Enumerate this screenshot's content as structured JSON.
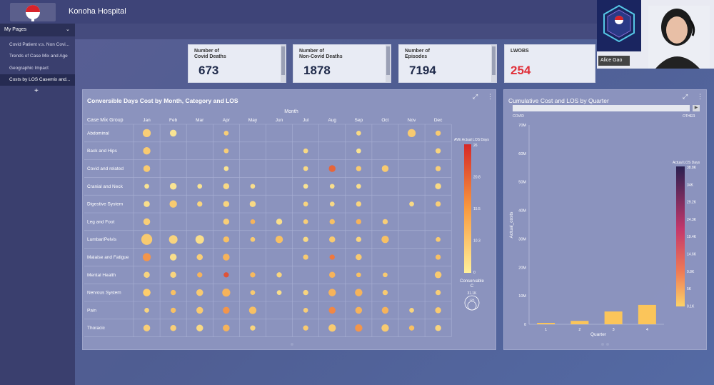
{
  "app": {
    "title": "Konoha Hospital"
  },
  "sidebar": {
    "header": "My Pages",
    "items": [
      {
        "label": "Covid Patient v.s. Non Covi..."
      },
      {
        "label": "Trends of Case Mix and Age"
      },
      {
        "label": "Geographic Impact"
      },
      {
        "label": "Costs by LOS Casemix and..."
      }
    ],
    "add_label": "+"
  },
  "kpis": [
    {
      "label": "Number of\nCovid Deaths",
      "value": "673",
      "color": "#1f2a4a"
    },
    {
      "label": "Number of\nNon-Covid Deaths",
      "value": "1878",
      "color": "#1f2a4a"
    },
    {
      "label": "Number of\nEpisodes",
      "value": "7194",
      "color": "#1f2a4a"
    },
    {
      "label": "LWOBS",
      "value": "254",
      "color": "#e0303a"
    }
  ],
  "video": {
    "name": "Alice Gao"
  },
  "chart_data": [
    {
      "type": "scatter",
      "title": "Conversible Days Cost by Month, Category and LOS",
      "xlabel": "Month",
      "ylabel": "Case Mix Group",
      "categories_x": [
        "Jan",
        "Feb",
        "Mar",
        "Apr",
        "May",
        "Jun",
        "Jul",
        "Aug",
        "Sep",
        "Oct",
        "Nov",
        "Dec"
      ],
      "categories_y": [
        "Abdominal",
        "Back and Hips",
        "Covid and related",
        "Cranial and Neck",
        "Digestive System",
        "Leg and Foot",
        "Lumbar/Pelvis",
        "Malaise and Fatigue",
        "Mental Health",
        "Nervous System",
        "Pain",
        "Thoracic"
      ],
      "color_legend": {
        "title": "AVE Actual LOS Days",
        "ticks": [
          "26",
          "20.8",
          "15.5",
          "10.3",
          "0"
        ]
      },
      "size_legend": {
        "title": "Conservable\nC",
        "ticks": [
          "31.1K",
          "12K"
        ]
      },
      "points": [
        [
          0,
          4,
          2,
          0.4,
          8
        ],
        [
          0,
          6,
          6,
          0.6,
          26
        ],
        [
          0,
          7,
          14,
          0.4,
          14
        ],
        [
          0,
          8,
          4,
          0.5,
          8
        ],
        [
          0,
          9,
          6,
          0.5,
          12
        ],
        [
          0,
          10,
          4,
          0.7,
          5
        ],
        [
          0,
          11,
          5,
          0.4,
          10
        ],
        [
          0,
          3,
          1,
          0.3,
          5
        ],
        [
          1,
          0,
          1,
          0.4,
          10
        ],
        [
          1,
          3,
          1,
          0.3,
          10
        ],
        [
          1,
          4,
          6,
          0.5,
          12
        ],
        [
          1,
          6,
          4,
          0.6,
          16
        ],
        [
          1,
          7,
          2,
          0.4,
          10
        ],
        [
          1,
          8,
          4,
          0.5,
          8
        ],
        [
          1,
          9,
          8,
          0.3,
          6
        ],
        [
          1,
          10,
          8,
          0.4,
          6
        ],
        [
          1,
          11,
          5,
          0.3,
          8
        ],
        [
          2,
          3,
          1,
          0.3,
          5
        ],
        [
          2,
          4,
          4,
          0.3,
          6
        ],
        [
          2,
          6,
          2,
          0.5,
          16
        ],
        [
          2,
          7,
          5,
          0.3,
          8
        ],
        [
          2,
          8,
          10,
          0.4,
          6
        ],
        [
          2,
          9,
          6,
          0.6,
          10
        ],
        [
          2,
          10,
          6,
          0.4,
          10
        ],
        [
          2,
          11,
          3,
          0.4,
          10
        ],
        [
          3,
          0,
          5,
          0.3,
          5
        ],
        [
          3,
          1,
          5,
          0.2,
          5
        ],
        [
          3,
          2,
          1,
          0.2,
          5
        ],
        [
          3,
          3,
          3,
          0.4,
          8
        ],
        [
          3,
          4,
          4,
          0.3,
          8
        ],
        [
          3,
          5,
          5,
          0.5,
          8
        ],
        [
          3,
          6,
          8,
          0.5,
          8
        ],
        [
          3,
          7,
          10,
          0.4,
          10
        ],
        [
          3,
          8,
          22,
          0.3,
          6
        ],
        [
          3,
          9,
          10,
          0.5,
          14
        ],
        [
          3,
          10,
          14,
          0.3,
          10
        ],
        [
          3,
          11,
          10,
          0.4,
          10
        ],
        [
          4,
          3,
          2,
          0.3,
          5
        ],
        [
          4,
          4,
          3,
          0.3,
          8
        ],
        [
          4,
          5,
          10,
          0.3,
          5
        ],
        [
          4,
          6,
          6,
          0.5,
          5
        ],
        [
          4,
          8,
          9,
          0.4,
          6
        ],
        [
          4,
          9,
          6,
          0.4,
          5
        ],
        [
          4,
          10,
          8,
          0.5,
          12
        ],
        [
          4,
          11,
          4,
          0.4,
          6
        ],
        [
          5,
          5,
          2,
          0.3,
          8
        ],
        [
          5,
          6,
          8,
          0.4,
          12
        ],
        [
          5,
          8,
          4,
          0.5,
          6
        ],
        [
          5,
          9,
          2,
          0.3,
          5
        ],
        [
          6,
          1,
          3,
          0.2,
          5
        ],
        [
          6,
          2,
          3,
          0.3,
          5
        ],
        [
          6,
          3,
          1,
          0.2,
          5
        ],
        [
          6,
          4,
          4,
          0.3,
          5
        ],
        [
          6,
          5,
          5,
          0.4,
          5
        ],
        [
          6,
          6,
          3,
          0.4,
          6
        ],
        [
          6,
          7,
          6,
          0.3,
          6
        ],
        [
          6,
          9,
          4,
          0.3,
          6
        ],
        [
          6,
          10,
          5,
          0.3,
          5
        ],
        [
          6,
          11,
          6,
          0.3,
          6
        ],
        [
          7,
          2,
          20,
          0.2,
          10
        ],
        [
          7,
          3,
          2,
          0.2,
          5
        ],
        [
          7,
          4,
          3,
          0.2,
          5
        ],
        [
          7,
          5,
          8,
          0.3,
          6
        ],
        [
          7,
          6,
          6,
          0.3,
          8
        ],
        [
          7,
          7,
          18,
          0.2,
          6
        ],
        [
          7,
          8,
          10,
          0.4,
          8
        ],
        [
          7,
          9,
          10,
          0.5,
          12
        ],
        [
          7,
          10,
          16,
          0.4,
          10
        ],
        [
          7,
          11,
          6,
          0.4,
          12
        ],
        [
          8,
          0,
          3,
          0.2,
          5
        ],
        [
          8,
          1,
          1,
          0.2,
          5
        ],
        [
          8,
          2,
          6,
          0.5,
          6
        ],
        [
          8,
          3,
          2,
          0.3,
          5
        ],
        [
          8,
          4,
          4,
          0.4,
          6
        ],
        [
          8,
          5,
          10,
          0.3,
          6
        ],
        [
          8,
          6,
          4,
          0.3,
          6
        ],
        [
          8,
          7,
          6,
          0.5,
          8
        ],
        [
          8,
          8,
          8,
          0.3,
          5
        ],
        [
          8,
          9,
          10,
          0.5,
          12
        ],
        [
          8,
          10,
          10,
          0.6,
          10
        ],
        [
          8,
          11,
          14,
          0.5,
          12
        ],
        [
          9,
          2,
          6,
          0.3,
          10
        ],
        [
          9,
          5,
          5,
          0.3,
          6
        ],
        [
          9,
          6,
          8,
          0.4,
          12
        ],
        [
          9,
          8,
          6,
          0.3,
          5
        ],
        [
          9,
          9,
          6,
          0.4,
          6
        ],
        [
          9,
          10,
          10,
          0.5,
          10
        ],
        [
          9,
          11,
          6,
          0.4,
          12
        ],
        [
          10,
          0,
          6,
          0.4,
          14
        ],
        [
          10,
          4,
          3,
          0.4,
          5
        ],
        [
          10,
          10,
          4,
          0.5,
          5
        ],
        [
          10,
          11,
          8,
          0.3,
          6
        ],
        [
          11,
          0,
          6,
          0.3,
          6
        ],
        [
          11,
          1,
          4,
          0.3,
          6
        ],
        [
          11,
          2,
          5,
          0.3,
          6
        ],
        [
          11,
          3,
          3,
          0.3,
          8
        ],
        [
          11,
          4,
          5,
          0.4,
          6
        ],
        [
          11,
          6,
          6,
          0.3,
          5
        ],
        [
          11,
          7,
          8,
          0.4,
          6
        ],
        [
          11,
          8,
          6,
          0.4,
          10
        ],
        [
          11,
          9,
          5,
          0.3,
          6
        ],
        [
          11,
          10,
          6,
          0.3,
          8
        ],
        [
          11,
          11,
          4,
          0.3,
          8
        ],
        [
          0,
          0,
          5,
          0.3,
          14
        ],
        [
          0,
          1,
          6,
          0.4,
          12
        ],
        [
          0,
          2,
          6,
          0.4,
          10
        ],
        [
          0,
          5,
          5,
          0.4,
          10
        ],
        [
          0,
          9,
          6,
          0.4,
          12
        ]
      ]
    },
    {
      "type": "bar",
      "title": "Cumulative Cost and LOS by Quarter",
      "xlabel": "Quarter",
      "ylabel": "Actual_costs",
      "categories": [
        "1",
        "2",
        "3",
        "4"
      ],
      "values": [
        0.5,
        1.2,
        4.5,
        6.8
      ],
      "yticks": [
        "0",
        "10M",
        "20M",
        "30M",
        "40M",
        "50M",
        "60M",
        "70M"
      ],
      "ylim": [
        0,
        70
      ],
      "slider_labels": [
        "COVID",
        "OTHER"
      ],
      "color_legend": {
        "title": "Actual LOS Days",
        "ticks": [
          "38.8K",
          "34K",
          "29.2K",
          "24.3K",
          "19.4K",
          "14.6K",
          "9.8K",
          "5K",
          "0.1K"
        ]
      }
    }
  ]
}
